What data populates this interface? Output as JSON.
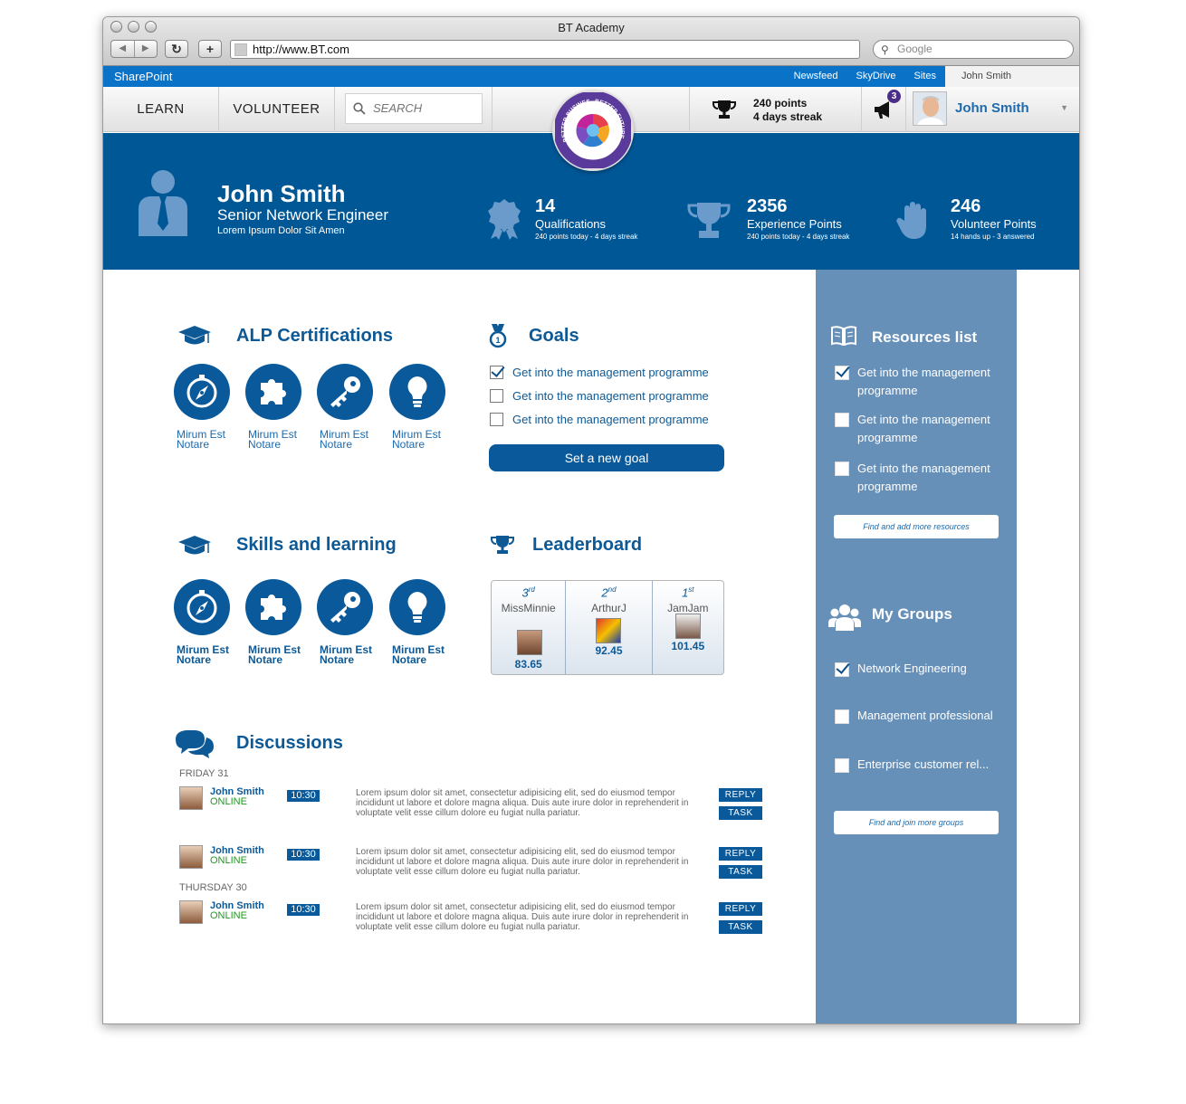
{
  "browser": {
    "window_title": "BT Academy",
    "url": "http://www.BT.com",
    "search_placeholder": "Google"
  },
  "sharepoint": {
    "brand": "SharePoint",
    "links": [
      "Newsfeed",
      "SkyDrive",
      "Sites"
    ],
    "user": "John Smith"
  },
  "topnav": {
    "learn": "LEARN",
    "volunteer": "VOLUNTEER",
    "search_placeholder": "SEARCH",
    "points_line1": "240 points",
    "points_line2": "4 days streak",
    "notifications": "3",
    "user_name": "John Smith",
    "logo_text_left": "BETTER BUSINESS",
    "logo_text_right": "BETTER FUTURE",
    "logo_text_bottom": "THE BT WAY"
  },
  "profile": {
    "name": "John Smith",
    "role": "Senior Network Engineer",
    "tagline": "Lorem Ipsum Dolor Sit Amen",
    "stats": [
      {
        "value": "14",
        "label": "Qualifications",
        "sub": "240 points today - 4 days streak",
        "icon": "award-ribbon-icon"
      },
      {
        "value": "2356",
        "label": "Experience Points",
        "sub": "240 points today - 4 days streak",
        "icon": "trophy-icon"
      },
      {
        "value": "246",
        "label": "Volunteer Points",
        "sub": "14 hands up - 3 answered",
        "icon": "hand-icon"
      }
    ]
  },
  "alp": {
    "title": "ALP Certifications",
    "items": [
      {
        "icon": "compass-icon",
        "line1": "Mirum Est",
        "line2": "Notare"
      },
      {
        "icon": "puzzle-icon",
        "line1": "Mirum Est",
        "line2": "Notare"
      },
      {
        "icon": "key-icon",
        "line1": "Mirum Est",
        "line2": "Notare"
      },
      {
        "icon": "lightbulb-icon",
        "line1": "Mirum Est",
        "line2": "Notare"
      }
    ]
  },
  "skills": {
    "title": "Skills and learning",
    "items": [
      {
        "icon": "compass-icon",
        "line1": "Mirum Est",
        "line2": "Notare"
      },
      {
        "icon": "puzzle-icon",
        "line1": "Mirum Est",
        "line2": "Notare"
      },
      {
        "icon": "key-icon",
        "line1": "Mirum Est",
        "line2": "Notare"
      },
      {
        "icon": "lightbulb-icon",
        "line1": "Mirum Est",
        "line2": "Notare"
      }
    ]
  },
  "goals": {
    "title": "Goals",
    "items": [
      {
        "label": "Get into the management programme",
        "checked": true
      },
      {
        "label": "Get into the management programme",
        "checked": false
      },
      {
        "label": "Get into the management programme",
        "checked": false
      }
    ],
    "button": "Set a new goal"
  },
  "leaderboard": {
    "title": "Leaderboard",
    "entries": [
      {
        "rank": "3",
        "suffix": "rd",
        "name": "MissMinnie",
        "score": "83.65"
      },
      {
        "rank": "2",
        "suffix": "nd",
        "name": "ArthurJ",
        "score": "92.45"
      },
      {
        "rank": "1",
        "suffix": "st",
        "name": "JamJam",
        "score": "101.45"
      }
    ]
  },
  "discussions": {
    "title": "Discussions",
    "day1": "FRIDAY 31",
    "day2": "THURSDAY 30",
    "posts": [
      {
        "name": "John Smith",
        "status": "ONLINE",
        "time": "10:30",
        "text": "Lorem ipsum dolor sit amet, consectetur adipisicing elit, sed do eiusmod tempor incididunt ut labore et dolore magna aliqua. Duis aute irure dolor in reprehenderit in voluptate velit esse cillum dolore eu fugiat nulla pariatur.",
        "reply": "REPLY",
        "task": "TASK"
      },
      {
        "name": "John Smith",
        "status": "ONLINE",
        "time": "10:30",
        "text": "Lorem ipsum dolor sit amet, consectetur adipisicing elit, sed do eiusmod tempor incididunt ut labore et dolore magna aliqua. Duis aute irure dolor in reprehenderit in voluptate velit esse cillum dolore eu fugiat nulla pariatur.",
        "reply": "REPLY",
        "task": "TASK"
      },
      {
        "name": "John Smith",
        "status": "ONLINE",
        "time": "10:30",
        "text": "Lorem ipsum dolor sit amet, consectetur adipisicing elit, sed do eiusmod tempor incididunt ut labore et dolore magna aliqua. Duis aute irure dolor in reprehenderit in voluptate velit esse cillum dolore eu fugiat nulla pariatur.",
        "reply": "REPLY",
        "task": "TASK"
      }
    ]
  },
  "resources": {
    "title": "Resources list",
    "items": [
      {
        "line1": "Get into the management",
        "line2": "programme",
        "checked": true
      },
      {
        "line1": "Get into the management",
        "line2": "programme",
        "checked": false
      },
      {
        "line1": "Get into the management",
        "line2": "programme",
        "checked": false
      }
    ],
    "button": "Find and add more resources"
  },
  "groups": {
    "title": "My Groups",
    "items": [
      {
        "label": "Network Engineering",
        "checked": true
      },
      {
        "label": "Management professional",
        "checked": false
      },
      {
        "label": "Enterprise customer rel...",
        "checked": false
      }
    ],
    "button": "Find and join more groups"
  },
  "colors": {
    "brand_blue": "#005796",
    "sharepoint_blue": "#0a73c8",
    "panel_blue": "#6790b9",
    "online_green": "#1f9a1f"
  }
}
